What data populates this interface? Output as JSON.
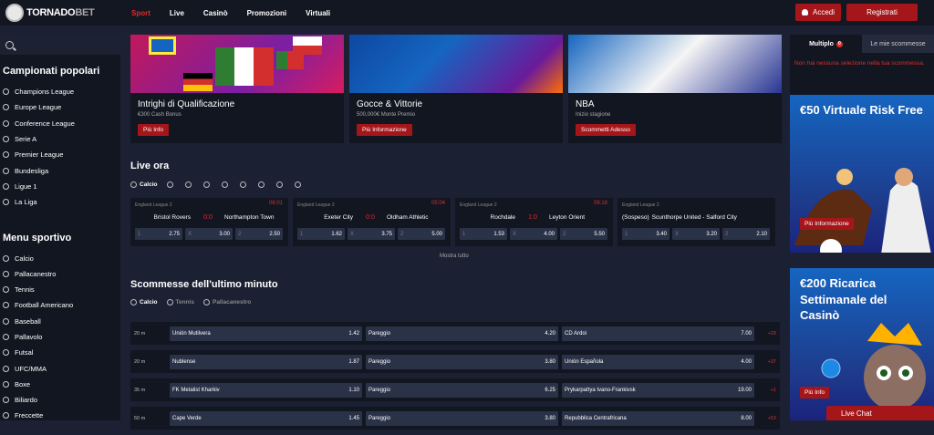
{
  "header": {
    "logo_prefix": "TORNADO",
    "logo_suffix": "BET",
    "nav": [
      "Sport",
      "Live",
      "Casinò",
      "Promozioni",
      "Virtuali"
    ],
    "login_label": "Accedi",
    "register_label": "Registrati"
  },
  "sidebar": {
    "popular_title": "Campionati popolari",
    "popular": [
      "Champions League",
      "Europe League",
      "Conference League",
      "Serie A",
      "Premier League",
      "Bundesliga",
      "Ligue 1",
      "La Liga"
    ],
    "menu_title": "Menu sportivo",
    "menu": [
      "Calcio",
      "Pallacanestro",
      "Tennis",
      "Football Americano",
      "Baseball",
      "Pallavolo",
      "Futsal",
      "UFC/MMA",
      "Boxe",
      "Biliardo",
      "Freccette"
    ]
  },
  "banners": [
    {
      "title": "Intrighi di Qualificazione",
      "sub": "€300 Cash Bonus",
      "btn": "Più Info"
    },
    {
      "title": "Gocce & Vittorie",
      "sub": "500,000€ Monte Premio",
      "btn": "Più Informazione"
    },
    {
      "title": "NBA",
      "sub": "Inizio stagione",
      "btn": "Scommetti Adesso"
    }
  ],
  "live": {
    "title": "Live ora",
    "tab": "Calcio",
    "show_all": "Mostra tutto",
    "matches": [
      {
        "league": "England League 2",
        "time": "06:01",
        "home": "Bristol Rovers",
        "score": "0:0",
        "away": "Northampton Town",
        "o1": "2.75",
        "ox": "3.00",
        "o2": "2.50"
      },
      {
        "league": "England League 2",
        "time": "05:04",
        "home": "Exeter City",
        "score": "0:0",
        "away": "Oldham Athletic",
        "o1": "1.62",
        "ox": "3.75",
        "o2": "5.00"
      },
      {
        "league": "England League 2",
        "time": "08:18",
        "home": "Rochdale",
        "score": "1:0",
        "away": "Leyton Orient",
        "o1": "1.53",
        "ox": "4.00",
        "o2": "5.50"
      },
      {
        "league": "England League 2",
        "time": "",
        "home": "(Sospeso)",
        "score": "",
        "away": "Scunthorpe United - Salford City",
        "o1": "3.40",
        "ox": "3.20",
        "o2": "2.10"
      }
    ],
    "odd_keys": [
      "1",
      "X",
      "2"
    ]
  },
  "last_minute": {
    "title": "Scommesse dell'ultimo minuto",
    "tabs": [
      "Calcio",
      "Tennis",
      "Pallacanestro"
    ],
    "rows": [
      {
        "time": "20 m",
        "home": "Unión Mutilvera",
        "o1": "1.42",
        "draw": "Pareggio",
        "ox": "4.20",
        "away": "CD Ardoi",
        "o2": "7.00",
        "more": "+29"
      },
      {
        "time": "20 m",
        "home": "Nublense",
        "o1": "1.87",
        "draw": "Pareggio",
        "ox": "3.80",
        "away": "Unión Española",
        "o2": "4.00",
        "more": "+37"
      },
      {
        "time": "35 m",
        "home": "FK Metalist Kharkiv",
        "o1": "1.10",
        "draw": "Pareggio",
        "ox": "6.25",
        "away": "Prykarpattya Ivano-Frankivsk",
        "o2": "19.00",
        "more": "+1"
      },
      {
        "time": "50 m",
        "home": "Cape Verde",
        "o1": "1.45",
        "draw": "Pareggio",
        "ox": "3.80",
        "away": "Repubblica Centrafricana",
        "o2": "8.00",
        "more": "+53"
      }
    ]
  },
  "betslip": {
    "tab_multi": "Multiplo",
    "tab_multi_count": "0",
    "tab_mine": "Le mie scommesse",
    "empty": "Non hai nessuna selezione nella tua scommessa."
  },
  "promos": [
    {
      "title": "€50 Virtuale Risk Free",
      "btn": "Più Informazione"
    },
    {
      "title": "€200 Ricarica Settimanale del Casinò",
      "btn": "Più Info"
    }
  ],
  "live_chat": "Live Chat"
}
